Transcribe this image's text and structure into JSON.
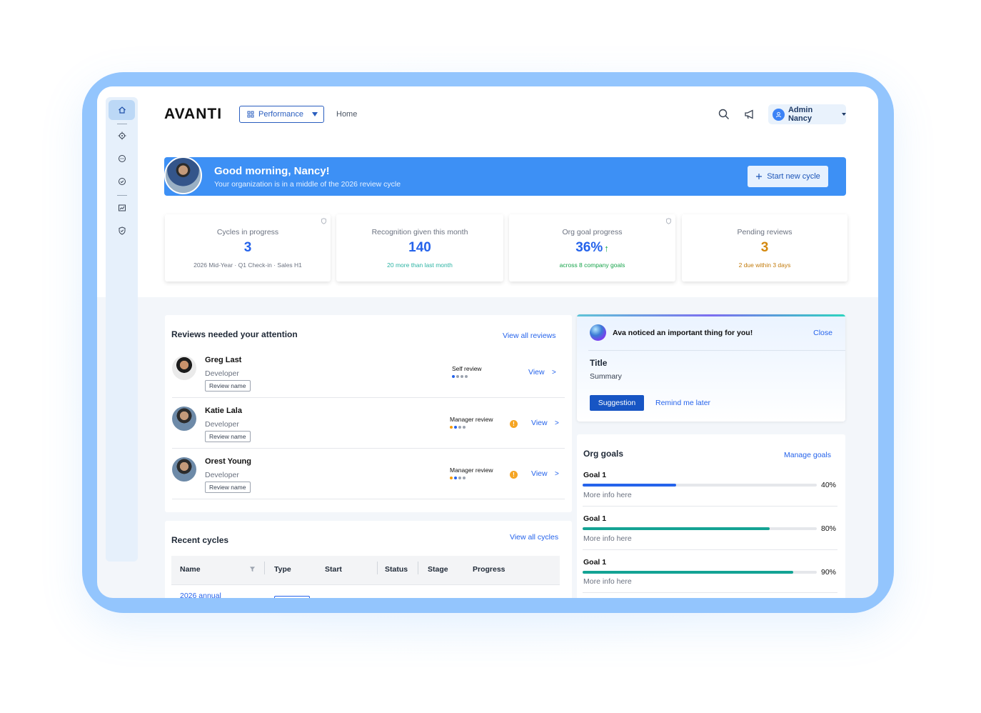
{
  "header": {
    "logo": "AVANTI",
    "module_label": "Performance",
    "breadcrumb": "Home",
    "user_label": "Admin Nancy"
  },
  "banner": {
    "title": "Good morning, Nancy!",
    "subtitle": "Your organization is in a middle of the 2026 review cycle",
    "action": "Start new cycle"
  },
  "stats": [
    {
      "label": "Cycles in progress",
      "value": "3",
      "sub": "2026 Mid-Year · Q1 Check-in · Sales H1",
      "value_color": "#2563eb",
      "sub_color": "#6b7280"
    },
    {
      "label": "Recognition given this month",
      "value": "140",
      "sub": "20 more than last month",
      "value_color": "#2563eb",
      "sub_color": "#2bb3a3"
    },
    {
      "label": "Org goal progress",
      "value": "36%",
      "sub": "across 8 company goals",
      "value_color": "#2563eb",
      "sub_color": "#16a34a"
    },
    {
      "label": "Pending reviews",
      "value": "3",
      "sub": "2 due within 3 days",
      "value_color": "#d4890f",
      "sub_color": "#c27a0a"
    }
  ],
  "reviews": {
    "title": "Reviews needed your attention",
    "view_all": "View all reviews",
    "items": [
      {
        "name": "Greg Last",
        "role": "Developer",
        "tag": "Review name",
        "type": "Self review",
        "action": "View"
      },
      {
        "name": "Katie Lala",
        "role": "Developer",
        "tag": "Review name",
        "type": "Manager review",
        "action": "View"
      },
      {
        "name": "Orest Young",
        "role": "Developer",
        "tag": "Review name",
        "type": "Manager review",
        "action": "View"
      }
    ]
  },
  "cycles": {
    "title": "Recent cycles",
    "view_all": "View all cycles",
    "columns": [
      "Name",
      "Type",
      "Start",
      "Status",
      "Stage",
      "Progress"
    ],
    "first_row_name": "2026 annual"
  },
  "ava": {
    "message": "Ava noticed an important thing for you!",
    "close": "Close",
    "title": "Title",
    "summary": "Summary",
    "primary": "Suggestion",
    "secondary": "Remind me later"
  },
  "goals": {
    "title": "Org goals",
    "manage": "Manage goals",
    "items": [
      {
        "name": "Goal 1",
        "progress": 0.4,
        "pct": "40%",
        "info": "More info here",
        "color": "#2563eb"
      },
      {
        "name": "Goal 1",
        "progress": 0.8,
        "pct": "80%",
        "info": "More info here",
        "color": "#14a394"
      },
      {
        "name": "Goal 1",
        "progress": 0.9,
        "pct": "90%",
        "info": "More info here",
        "color": "#14a394"
      }
    ]
  }
}
